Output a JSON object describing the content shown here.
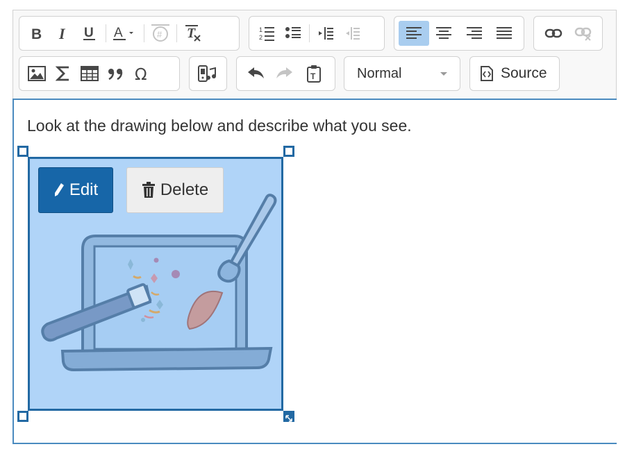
{
  "toolbar": {
    "format_select": {
      "value": "Normal"
    },
    "source_button": {
      "label": "Source"
    }
  },
  "editor": {
    "paragraph": "Look at the drawing below and describe what you see.",
    "image_widget": {
      "edit_label": "Edit",
      "delete_label": "Delete"
    }
  },
  "colors": {
    "accent": "#1766a8",
    "selection": "#2269a3",
    "image_bg": "#b0d4f8",
    "active_button": "#a9cdef"
  }
}
